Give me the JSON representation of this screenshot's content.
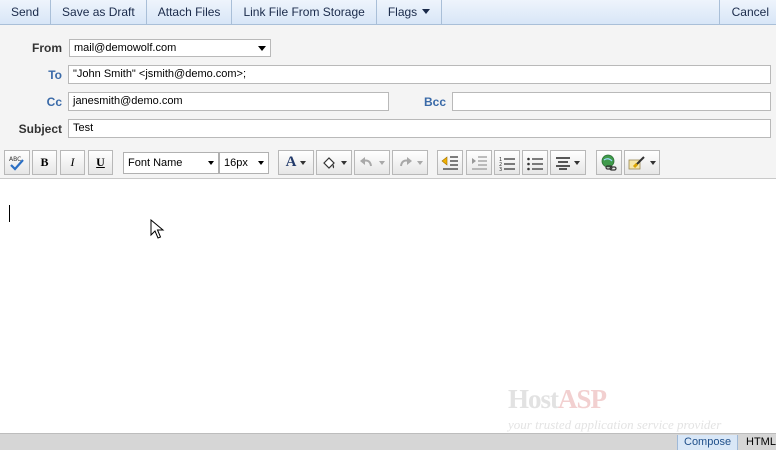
{
  "actions": {
    "send": "Send",
    "save_draft": "Save as Draft",
    "attach_files": "Attach Files",
    "link_file": "Link File From Storage",
    "flags": "Flags",
    "cancel": "Cancel"
  },
  "compose": {
    "from_label": "From",
    "from_value": "mail@demowolf.com",
    "to_label": "To",
    "to_value": "\"John Smith\" <jsmith@demo.com>;",
    "cc_label": "Cc",
    "cc_value": "janesmith@demo.com",
    "bcc_label": "Bcc",
    "bcc_value": "",
    "subject_label": "Subject",
    "subject_value": "Test"
  },
  "toolbar": {
    "bold": "B",
    "italic": "I",
    "underline": "U",
    "font_name": "Font Name",
    "font_size": "16px",
    "font_color": "A"
  },
  "watermark": {
    "brand_host": "Host",
    "brand_asp": "ASP",
    "tagline": "your trusted application service provider"
  },
  "modes": {
    "compose": "Compose",
    "html": "HTML"
  },
  "colors": {
    "label_blue": "#3a6aa8",
    "bar_blue": "#d8e6f7"
  }
}
